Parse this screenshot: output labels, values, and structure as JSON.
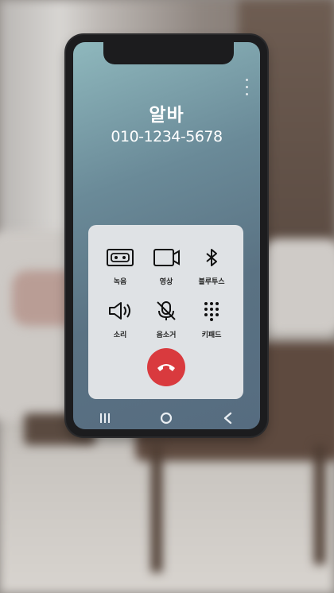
{
  "call": {
    "name": "알바",
    "number": "010-1234-5678"
  },
  "controls": [
    {
      "label": "녹음",
      "icon": "record-icon"
    },
    {
      "label": "영상",
      "icon": "video-icon"
    },
    {
      "label": "블루투스",
      "icon": "bluetooth-icon"
    },
    {
      "label": "소리",
      "icon": "speaker-icon"
    },
    {
      "label": "음소거",
      "icon": "mute-icon"
    },
    {
      "label": "키패드",
      "icon": "keypad-icon"
    }
  ],
  "colors": {
    "end_call": "#d93a3e",
    "panel": "#dfe2e5",
    "screen_top": "#8fb8bd",
    "screen_bottom": "#566c80"
  },
  "navbar": {
    "buttons": [
      "recent-apps-icon",
      "home-icon",
      "back-icon"
    ]
  }
}
